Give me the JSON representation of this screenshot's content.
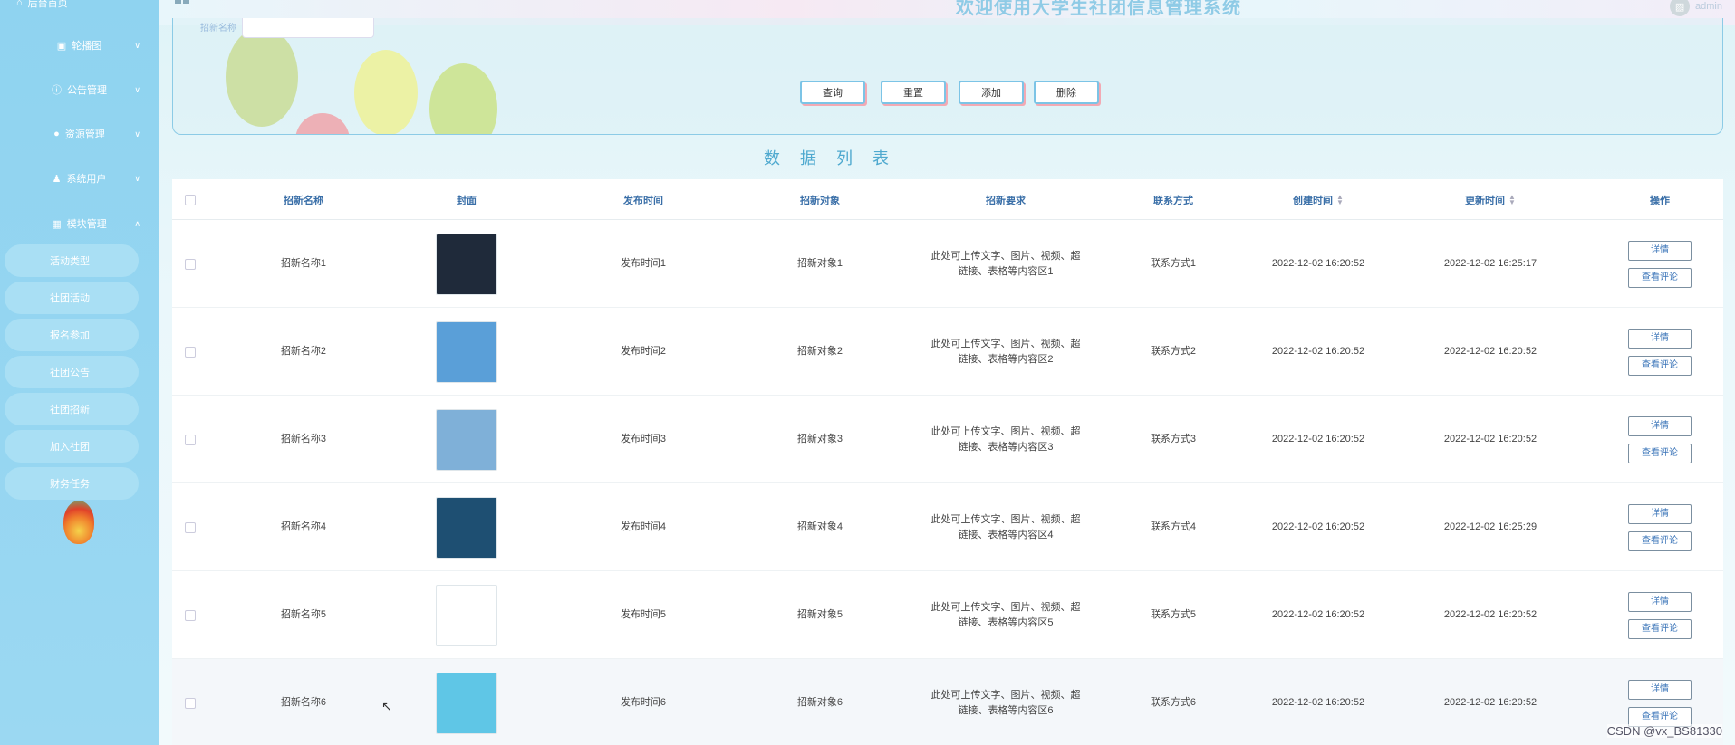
{
  "app": {
    "title": "欢迎使用大学生社团信息管理系统",
    "user": "admin"
  },
  "sidebar": {
    "home": "后台首页",
    "menus": [
      {
        "label": "轮播图",
        "icon": "image-icon"
      },
      {
        "label": "公告管理",
        "icon": "info-icon"
      },
      {
        "label": "资源管理",
        "icon": "pin-icon"
      },
      {
        "label": "系统用户",
        "icon": "user-icon"
      },
      {
        "label": "模块管理",
        "icon": "grid-icon"
      }
    ],
    "submenus": [
      "活动类型",
      "社团活动",
      "报名参加",
      "社团公告",
      "社团招新",
      "加入社团",
      "财务任务"
    ]
  },
  "search": {
    "label": "招新名称",
    "query_button": "查询",
    "reset_button": "重置",
    "add_button": "添加",
    "delete_button": "删除"
  },
  "section_title": "数据列表",
  "table": {
    "headers": [
      "招新名称",
      "封面",
      "发布时间",
      "招新对象",
      "招新要求",
      "联系方式",
      "创建时间",
      "更新时间",
      "操作"
    ],
    "rows": [
      {
        "name": "招新名称1",
        "pub": "发布时间1",
        "target": "招新对象1",
        "req": "此处可上传文字、图片、视频、超链接、表格等内容区1",
        "contact": "联系方式1",
        "created": "2022-12-02 16:20:52",
        "updated": "2022-12-02 16:25:17",
        "cover_color": "#1f2a3a"
      },
      {
        "name": "招新名称2",
        "pub": "发布时间2",
        "target": "招新对象2",
        "req": "此处可上传文字、图片、视频、超链接、表格等内容区2",
        "contact": "联系方式2",
        "created": "2022-12-02 16:20:52",
        "updated": "2022-12-02 16:20:52",
        "cover_color": "#5a9fd8"
      },
      {
        "name": "招新名称3",
        "pub": "发布时间3",
        "target": "招新对象3",
        "req": "此处可上传文字、图片、视频、超链接、表格等内容区3",
        "contact": "联系方式3",
        "created": "2022-12-02 16:20:52",
        "updated": "2022-12-02 16:20:52",
        "cover_color": "#7fb0d8"
      },
      {
        "name": "招新名称4",
        "pub": "发布时间4",
        "target": "招新对象4",
        "req": "此处可上传文字、图片、视频、超链接、表格等内容区4",
        "contact": "联系方式4",
        "created": "2022-12-02 16:20:52",
        "updated": "2022-12-02 16:25:29",
        "cover_color": "#1e4f72"
      },
      {
        "name": "招新名称5",
        "pub": "发布时间5",
        "target": "招新对象5",
        "req": "此处可上传文字、图片、视频、超链接、表格等内容区5",
        "contact": "联系方式5",
        "created": "2022-12-02 16:20:52",
        "updated": "2022-12-02 16:20:52",
        "cover_color": "#ffffff"
      },
      {
        "name": "招新名称6",
        "pub": "发布时间6",
        "target": "招新对象6",
        "req": "此处可上传文字、图片、视频、超链接、表格等内容区6",
        "contact": "联系方式6",
        "created": "2022-12-02 16:20:52",
        "updated": "2022-12-02 16:20:52",
        "cover_color": "#5fc6e6"
      }
    ],
    "detail_label": "详情",
    "comment_label": "查看评论"
  },
  "watermark": "CSDN @vx_BS81330",
  "colors": {
    "sidebar": "#9bd8f2",
    "accent": "#3a74b8",
    "button_border": "#7cc4e6"
  }
}
